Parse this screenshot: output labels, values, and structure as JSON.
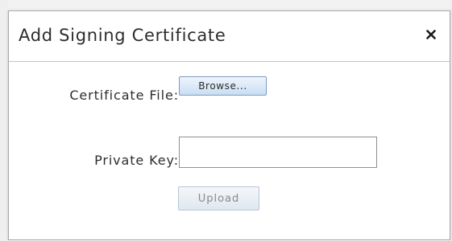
{
  "dialog": {
    "title": "Add Signing Certificate",
    "close_icon": "close-icon"
  },
  "form": {
    "certificate_label": "Certificate File:",
    "browse_label": "Browse...",
    "private_key_label": "Private Key:",
    "private_key_value": "",
    "private_key_placeholder": "",
    "upload_label": "Upload",
    "upload_disabled": true
  },
  "colors": {
    "browse_border": "#7c9cc0",
    "browse_gradient_top": "#eef5fc",
    "browse_gradient_bottom": "#c9def2",
    "upload_text": "#8a8a8a",
    "title_text": "#2d2d2d"
  }
}
